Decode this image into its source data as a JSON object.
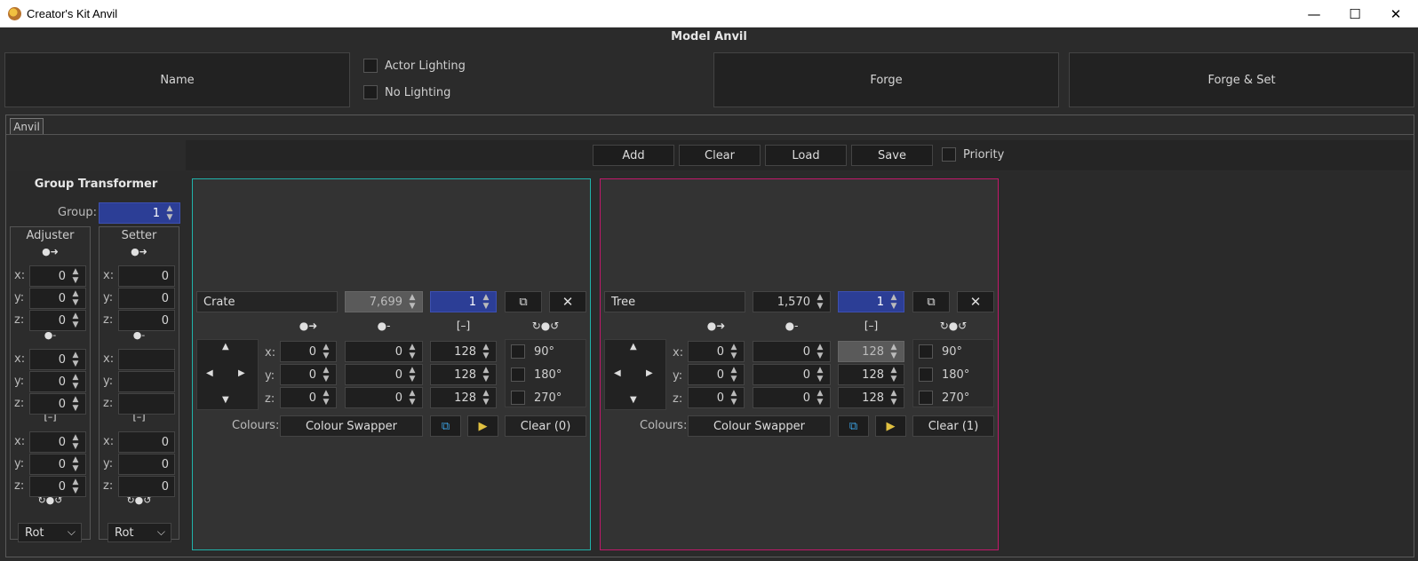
{
  "window": {
    "title": "Creator's Kit Anvil",
    "minimize": "—",
    "maximize": "☐",
    "close": "✕"
  },
  "header": {
    "title": "Model Anvil",
    "name_button": "Name",
    "actor_lighting": "Actor Lighting",
    "no_lighting": "No Lighting",
    "forge": "Forge",
    "forge_set": "Forge & Set"
  },
  "tabs": [
    "Anvil"
  ],
  "toolbar": {
    "add": "Add",
    "clear": "Clear",
    "load": "Load",
    "save": "Save",
    "priority": "Priority"
  },
  "group_transformer": {
    "title": "Group Transformer",
    "group_label": "Group:",
    "group_value": "1",
    "adjuster": {
      "title": "Adjuster",
      "move": {
        "x": "0",
        "y": "0",
        "z": "0"
      },
      "offset": {
        "x": "0",
        "y": "0",
        "z": "0"
      },
      "scale": {
        "x": "0",
        "y": "0",
        "z": "0"
      },
      "mode": "Rot"
    },
    "setter": {
      "title": "Setter",
      "move": {
        "x": "0",
        "y": "0",
        "z": "0"
      },
      "offset": {
        "x": "",
        "y": "",
        "z": ""
      },
      "scale": {
        "x": "0",
        "y": "0",
        "z": "0"
      },
      "mode": "Rot"
    }
  },
  "icons": {
    "move": "●➜",
    "offset": "●-",
    "scale": "[–]",
    "rotate": "↻●↺",
    "up": "▲",
    "down": "▼",
    "left": "◀",
    "right": "▶",
    "spin": "▲▼",
    "copy": "⧉",
    "close": "✕",
    "chev": "⌄"
  },
  "axes": {
    "x": "x:",
    "y": "y:",
    "z": "z:"
  },
  "models": [
    {
      "name": "Crate",
      "id": "7,699",
      "group": "1",
      "move": {
        "x": "0",
        "y": "0",
        "z": "0"
      },
      "offset": {
        "x": "0",
        "y": "0",
        "z": "0"
      },
      "scale": {
        "x": "128",
        "y": "128",
        "z": "128"
      },
      "rot": [
        "90°",
        "180°",
        "270°"
      ],
      "colours_label": "Colours:",
      "colour_swapper": "Colour Swapper",
      "clear": "Clear (0)",
      "outline": "#20b2aa"
    },
    {
      "name": "Tree",
      "id": "1,570",
      "group": "1",
      "move": {
        "x": "0",
        "y": "0",
        "z": "0"
      },
      "offset": {
        "x": "0",
        "y": "0",
        "z": "0"
      },
      "scale": {
        "x": "128",
        "y": "128",
        "z": "128"
      },
      "rot": [
        "90°",
        "180°",
        "270°"
      ],
      "colours_label": "Colours:",
      "colour_swapper": "Colour Swapper",
      "clear": "Clear (1)",
      "outline": "#c2186b"
    }
  ]
}
